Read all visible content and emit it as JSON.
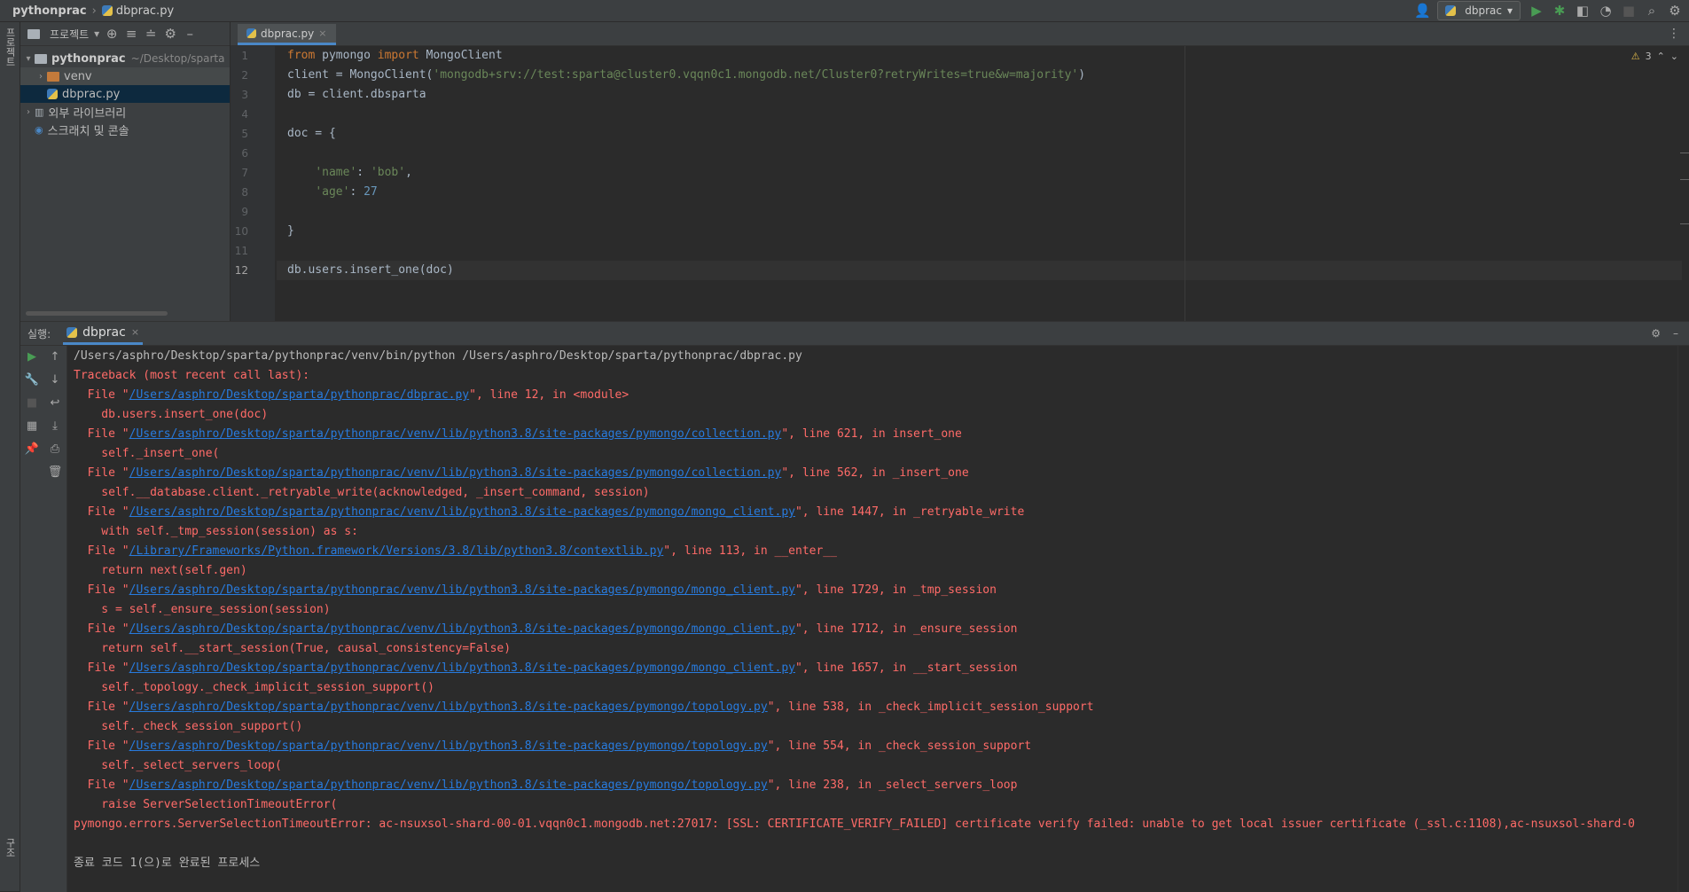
{
  "navbar": {
    "project": "pythonprac",
    "file": "dbprac.py",
    "run_config": "dbprac"
  },
  "left_strip": {
    "project_tab": "프로젝트",
    "structure_tab": "구조"
  },
  "project_panel": {
    "header_label": "프로젝트",
    "root_name": "pythonprac",
    "root_path": "~/Desktop/sparta",
    "items": [
      {
        "label": "venv"
      },
      {
        "label": "dbprac.py"
      },
      {
        "label": "외부 라이브러리"
      },
      {
        "label": "스크래치 및 콘솔"
      }
    ]
  },
  "editor": {
    "tab_label": "dbprac.py",
    "warning_count": "3",
    "line_numbers": [
      "1",
      "2",
      "3",
      "4",
      "5",
      "6",
      "7",
      "8",
      "9",
      "10",
      "11",
      "12"
    ],
    "code": {
      "l1_kw1": "from",
      "l1_mod": " pymongo ",
      "l1_kw2": "import",
      "l1_cls": " MongoClient",
      "l2_pre": "client = MongoClient(",
      "l2_str": "'mongodb+srv://test:sparta@cluster0.vqqn0c1.mongodb.net/Cluster0?retryWrites=true&w=majority'",
      "l2_post": ")",
      "l3": "db = client.dbsparta",
      "l5": "doc = {",
      "l7_str1": "'name'",
      "l7_mid": ": ",
      "l7_str2": "'bob'",
      "l7_end": ",",
      "l8_str": "'age'",
      "l8_mid": ": ",
      "l8_num": "27",
      "l10": "}",
      "l12": "db.users.insert_one(doc)"
    }
  },
  "run_panel": {
    "label": "실행:",
    "tab": "dbprac",
    "command": "/Users/asphro/Desktop/sparta/pythonprac/venv/bin/python /Users/asphro/Desktop/sparta/pythonprac/dbprac.py",
    "traceback_header": "Traceback (most recent call last):",
    "frames": [
      {
        "path": "/Users/asphro/Desktop/sparta/pythonprac/dbprac.py",
        "tail": "\", line 12, in <module>",
        "code": "    db.users.insert_one(doc)"
      },
      {
        "path": "/Users/asphro/Desktop/sparta/pythonprac/venv/lib/python3.8/site-packages/pymongo/collection.py",
        "tail": "\", line 621, in insert_one",
        "code": "    self._insert_one("
      },
      {
        "path": "/Users/asphro/Desktop/sparta/pythonprac/venv/lib/python3.8/site-packages/pymongo/collection.py",
        "tail": "\", line 562, in _insert_one",
        "code": "    self.__database.client._retryable_write(acknowledged, _insert_command, session)"
      },
      {
        "path": "/Users/asphro/Desktop/sparta/pythonprac/venv/lib/python3.8/site-packages/pymongo/mongo_client.py",
        "tail": "\", line 1447, in _retryable_write",
        "code": "    with self._tmp_session(session) as s:"
      },
      {
        "path": "/Library/Frameworks/Python.framework/Versions/3.8/lib/python3.8/contextlib.py",
        "tail": "\", line 113, in __enter__",
        "code": "    return next(self.gen)"
      },
      {
        "path": "/Users/asphro/Desktop/sparta/pythonprac/venv/lib/python3.8/site-packages/pymongo/mongo_client.py",
        "tail": "\", line 1729, in _tmp_session",
        "code": "    s = self._ensure_session(session)"
      },
      {
        "path": "/Users/asphro/Desktop/sparta/pythonprac/venv/lib/python3.8/site-packages/pymongo/mongo_client.py",
        "tail": "\", line 1712, in _ensure_session",
        "code": "    return self.__start_session(True, causal_consistency=False)"
      },
      {
        "path": "/Users/asphro/Desktop/sparta/pythonprac/venv/lib/python3.8/site-packages/pymongo/mongo_client.py",
        "tail": "\", line 1657, in __start_session",
        "code": "    self._topology._check_implicit_session_support()"
      },
      {
        "path": "/Users/asphro/Desktop/sparta/pythonprac/venv/lib/python3.8/site-packages/pymongo/topology.py",
        "tail": "\", line 538, in _check_implicit_session_support",
        "code": "    self._check_session_support()"
      },
      {
        "path": "/Users/asphro/Desktop/sparta/pythonprac/venv/lib/python3.8/site-packages/pymongo/topology.py",
        "tail": "\", line 554, in _check_session_support",
        "code": "    self._select_servers_loop("
      },
      {
        "path": "/Users/asphro/Desktop/sparta/pythonprac/venv/lib/python3.8/site-packages/pymongo/topology.py",
        "tail": "\", line 238, in _select_servers_loop",
        "code": "    raise ServerSelectionTimeoutError("
      }
    ],
    "file_prefix": "  File \"",
    "error": "pymongo.errors.ServerSelectionTimeoutError: ac-nsuxsol-shard-00-01.vqqn0c1.mongodb.net:27017: [SSL: CERTIFICATE_VERIFY_FAILED] certificate verify failed: unable to get local issuer certificate (_ssl.c:1108),ac-nsuxsol-shard-0",
    "exit": "종료 코드 1(으)로 완료된 프로세스"
  },
  "colors": {
    "error": "#ff6b68",
    "link": "#287bde",
    "keyword": "#cc7832",
    "string": "#6a8759",
    "number": "#6897bb"
  }
}
